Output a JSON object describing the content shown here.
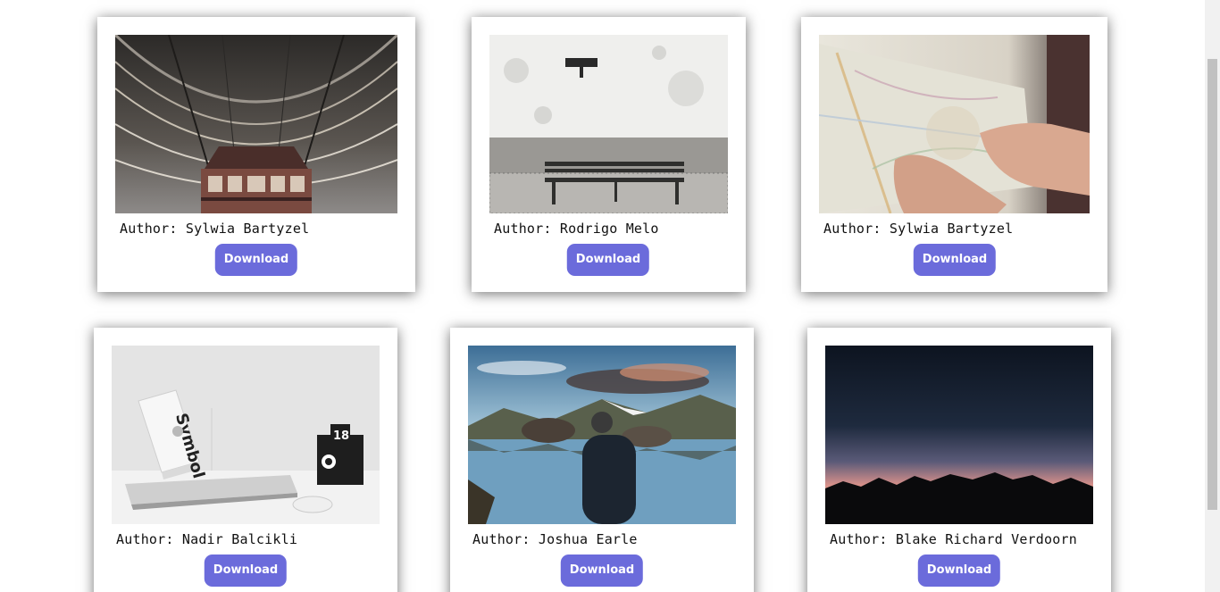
{
  "gallery": {
    "author_prefix": "Author:",
    "cards": [
      {
        "author": "Sylwia Bartyzel",
        "button": "Download",
        "photo": "train-station-roof-photo"
      },
      {
        "author": "Rodrigo Melo",
        "button": "Download",
        "photo": "bench-wall-photo"
      },
      {
        "author": "Sylwia Bartyzel",
        "button": "Download",
        "photo": "hand-map-photo"
      },
      {
        "author": "Nadir Balcikli",
        "button": "Download",
        "photo": "desk-laptop-photo"
      },
      {
        "author": "Joshua Earle",
        "button": "Download",
        "photo": "lake-mountains-man-photo"
      },
      {
        "author": "Blake Richard Verdoorn",
        "button": "Download",
        "photo": "sunset-mountains-photo"
      }
    ]
  },
  "photo_labels": {
    "book_title": "Symbol",
    "calendar_day": "18"
  },
  "colors": {
    "button": "#6b6bdb",
    "button_text": "#ffffff"
  }
}
